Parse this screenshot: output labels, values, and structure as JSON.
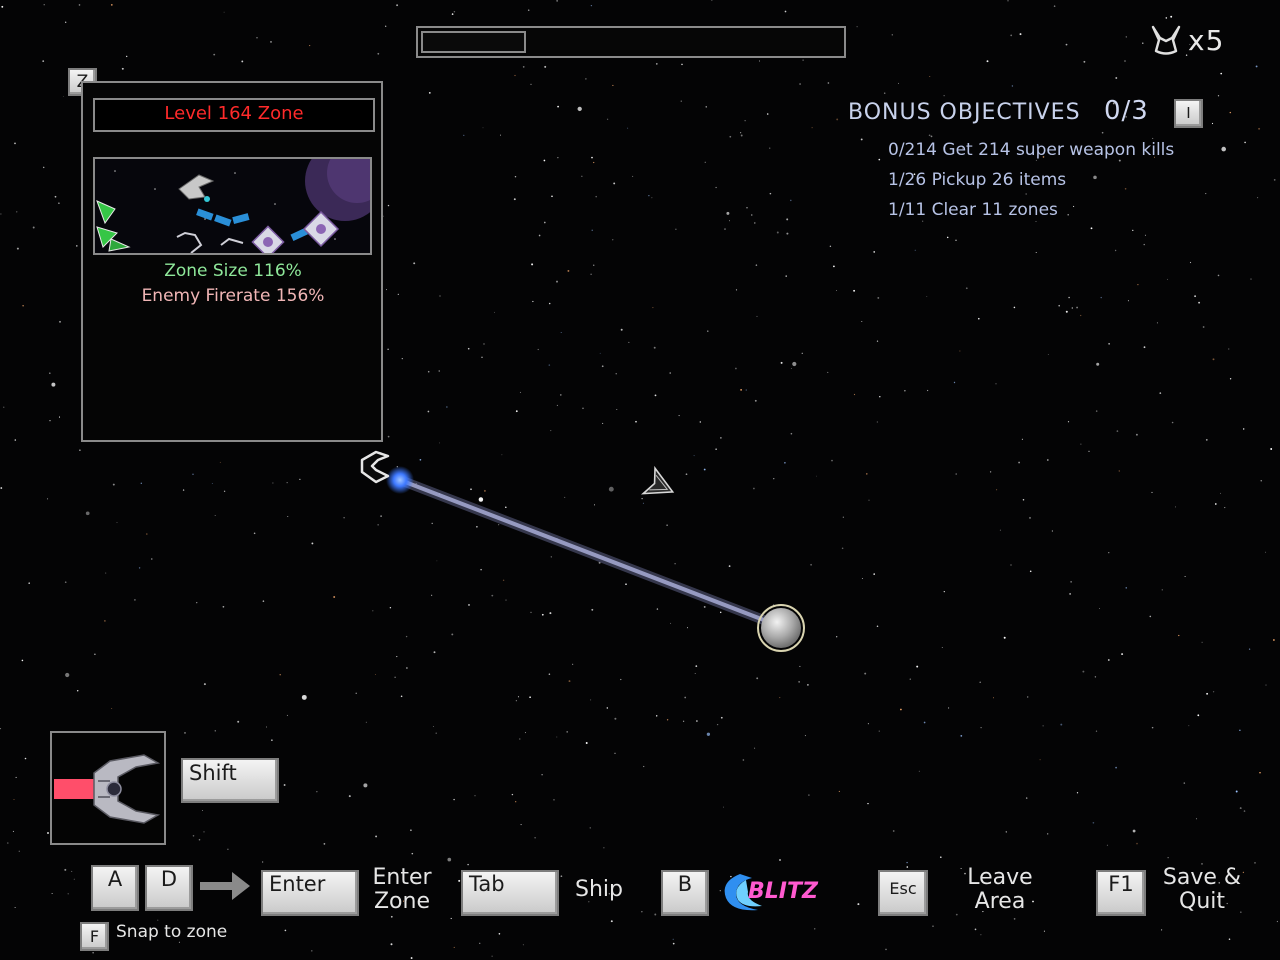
{
  "hud": {
    "progress": 0.25,
    "lives_text": "x5",
    "lives_icon": "player-ship-lives-icon"
  },
  "zone_panel": {
    "key_label": "Z",
    "title": "Level 164 Zone",
    "zone_size": "Zone Size 116%",
    "enemy_firerate": "Enemy Firerate 156%",
    "colors": {
      "title": "#ff2a2a",
      "zone_size": "#8fe89a",
      "enemy_firerate": "#f1b6b6"
    }
  },
  "bonus": {
    "title": "BONUS OBJECTIVES",
    "count": "0/3",
    "key_label": "I",
    "objectives": [
      "0/214 Get 214 super weapon kills",
      "1/26 Pickup 26 items",
      "1/11 Clear 11 zones"
    ]
  },
  "ship_slot": {
    "key_label": "Shift",
    "accent": "#ff4e6a"
  },
  "controls": {
    "key_a": "A",
    "key_d": "D",
    "key_enter": "Enter",
    "enter_line1": "Enter",
    "enter_line2": "Zone",
    "key_tab": "Tab",
    "ship_label": "Ship",
    "key_b": "B",
    "blitz_text": "BLITZ",
    "key_esc": "Esc",
    "leave_line1": "Leave",
    "leave_line2": "Area",
    "key_f1": "F1",
    "save_line1": "Save &",
    "save_line2": "Quit",
    "key_f": "F",
    "snap_label": "Snap to zone"
  }
}
